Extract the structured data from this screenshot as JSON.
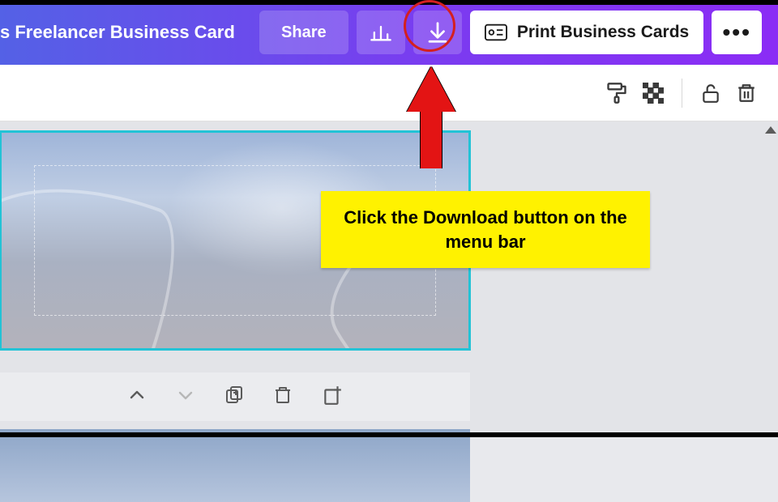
{
  "menubar": {
    "doc_title": "s Freelancer Business Card",
    "share_label": "Share",
    "print_label": "Print Business Cards"
  },
  "callout": {
    "tooltip_text": "Click the Download button on the menu bar"
  },
  "icons": {
    "analytics": "analytics-icon",
    "download": "download-icon",
    "print": "print-badge-icon",
    "more": "more-icon",
    "paint_roller": "paint-roller-icon",
    "transparency": "transparency-icon",
    "lock": "lock-open-icon",
    "trash": "trash-icon",
    "chevron_up": "chevron-up-icon",
    "chevron_down": "chevron-down-icon",
    "duplicate": "duplicate-icon",
    "add_page": "add-page-icon"
  }
}
